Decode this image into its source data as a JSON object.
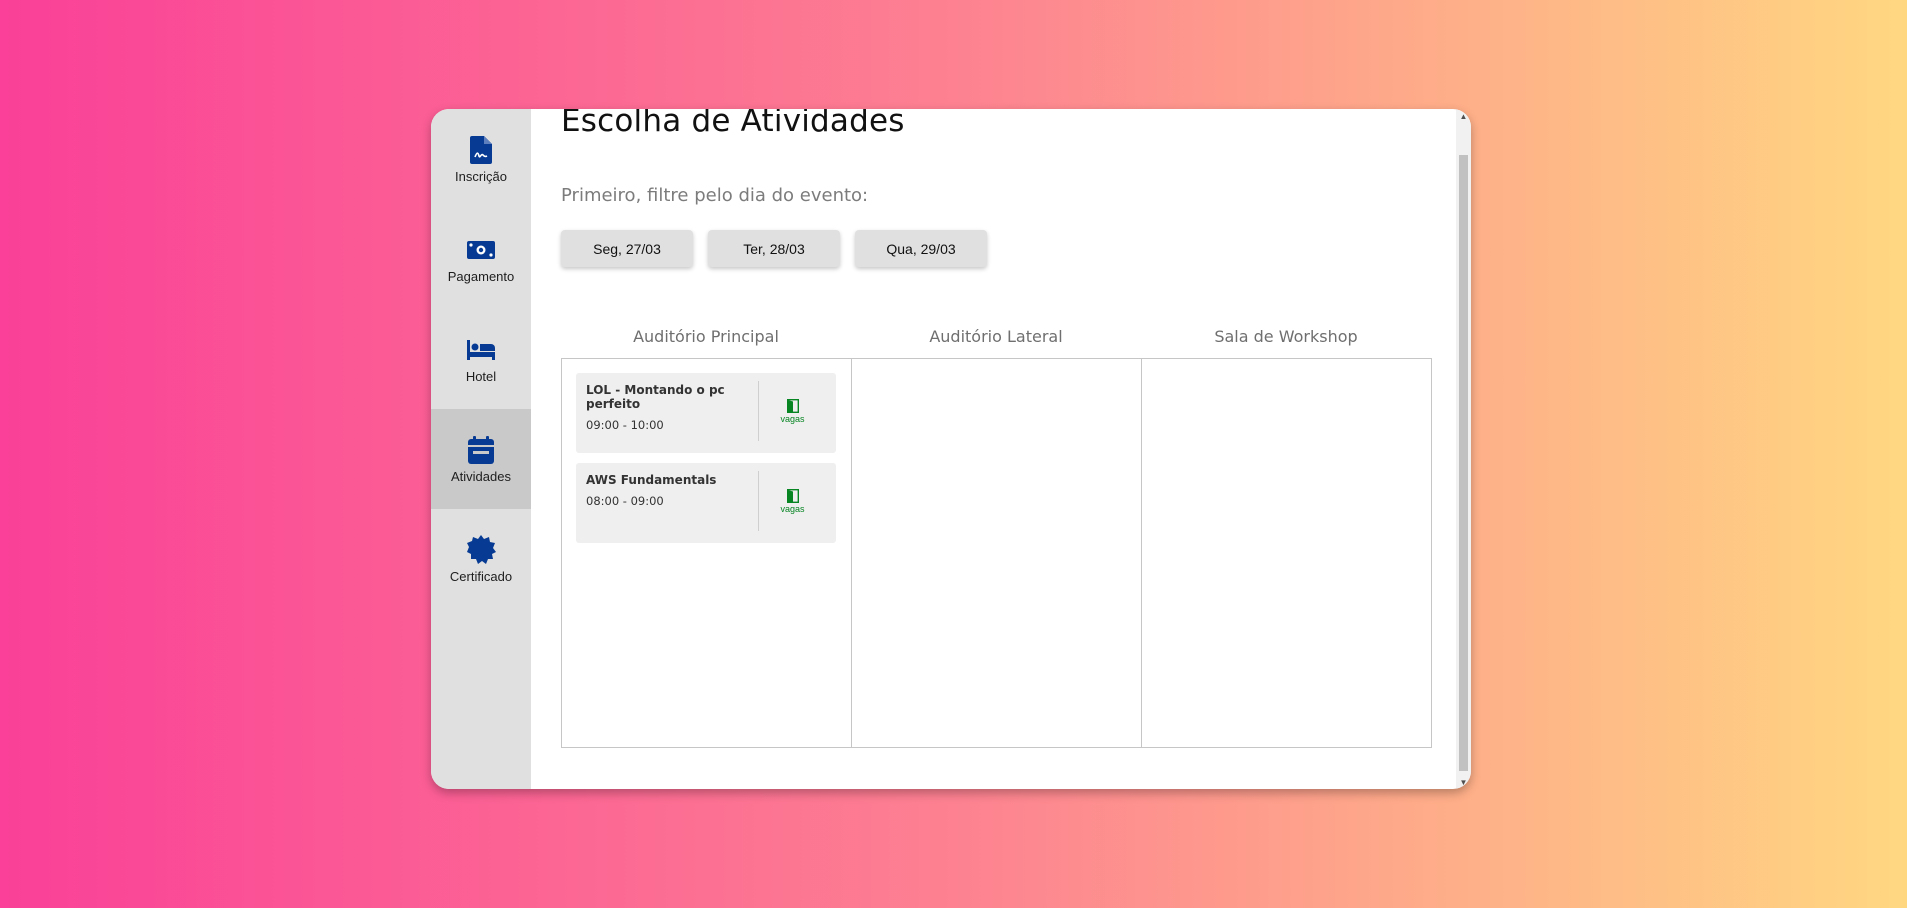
{
  "sidebar": {
    "items": [
      {
        "label": "Inscrição",
        "icon": "document-signature-icon",
        "active": false
      },
      {
        "label": "Pagamento",
        "icon": "money-bill-icon",
        "active": false
      },
      {
        "label": "Hotel",
        "icon": "bed-icon",
        "active": false
      },
      {
        "label": "Atividades",
        "icon": "calendar-icon",
        "active": true
      },
      {
        "label": "Certificado",
        "icon": "certificate-badge-icon",
        "active": false
      }
    ]
  },
  "main": {
    "title": "Escolha de Atividades",
    "filter_label": "Primeiro, filtre pelo dia do evento:",
    "days": [
      "Seg, 27/03",
      "Ter, 28/03",
      "Qua, 29/03"
    ],
    "rooms": [
      {
        "name": "Auditório Principal",
        "activities": [
          {
            "title": "LOL - Montando o pc perfeito",
            "time": "09:00 - 10:00",
            "slots_label": "vagas",
            "slots_icon": "door-open-icon"
          },
          {
            "title": "AWS Fundamentals",
            "time": "08:00 - 09:00",
            "slots_label": "vagas",
            "slots_icon": "door-open-icon"
          }
        ]
      },
      {
        "name": "Auditório Lateral",
        "activities": []
      },
      {
        "name": "Sala de Workshop",
        "activities": []
      }
    ]
  },
  "colors": {
    "icon_blue": "#073b93",
    "slots_green": "#078523",
    "sidebar_bg": "#e0e0e0",
    "sidebar_active_bg": "#c9c9c9",
    "background_gradient": [
      "#fa4098",
      "#fd8191",
      "#ffd781"
    ]
  }
}
